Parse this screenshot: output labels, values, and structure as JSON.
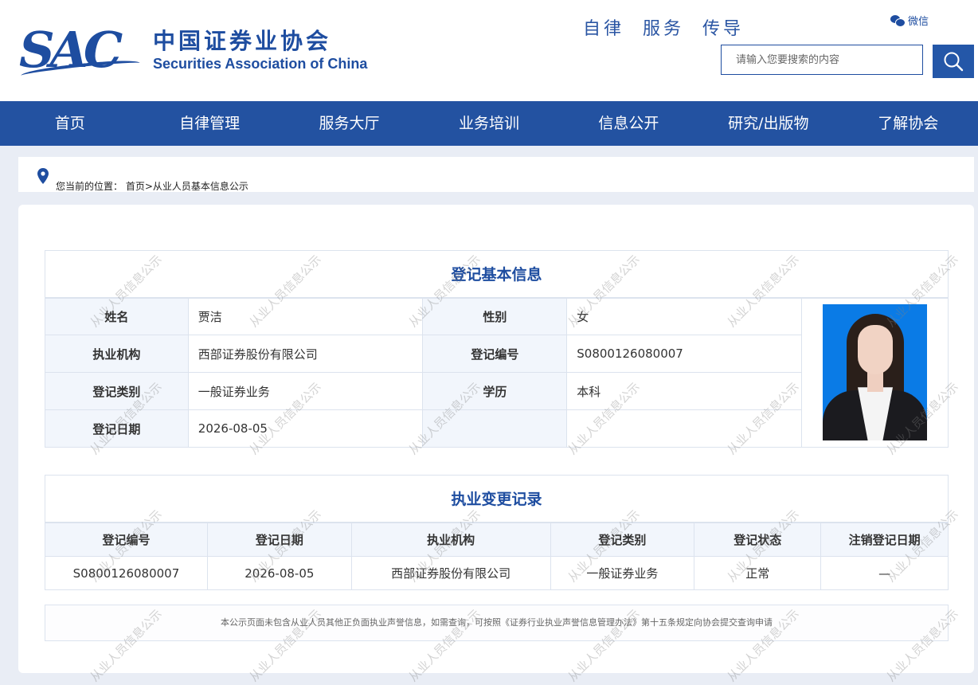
{
  "header": {
    "logo_abbr": "SAC",
    "logo_cn": "中国证券业协会",
    "logo_en": "Securities Association of China",
    "slogan": "自律 服务 传导",
    "wechat_label": "微信",
    "search_placeholder": "请输入您要搜索的内容"
  },
  "nav": {
    "items": [
      "首页",
      "自律管理",
      "服务大厅",
      "业务培训",
      "信息公开",
      "研究/出版物",
      "了解协会"
    ]
  },
  "breadcrumb": {
    "prefix": "您当前的位置：",
    "home": "首页",
    "separator": ">",
    "current": "从业人员基本信息公示"
  },
  "basic_info": {
    "title": "登记基本信息",
    "labels": {
      "name": "姓名",
      "gender": "性别",
      "org": "执业机构",
      "reg_no": "登记编号",
      "reg_type": "登记类别",
      "education": "学历",
      "reg_date": "登记日期"
    },
    "values": {
      "name": "贾洁",
      "gender": "女",
      "org": "西部证券股份有限公司",
      "reg_no": "S0800126080007",
      "reg_type": "一般证券业务",
      "education": "本科",
      "reg_date": "2026-08-05"
    }
  },
  "change_records": {
    "title": "执业变更记录",
    "headers": [
      "登记编号",
      "登记日期",
      "执业机构",
      "登记类别",
      "登记状态",
      "注销登记日期"
    ],
    "rows": [
      [
        "S0800126080007",
        "2026-08-05",
        "西部证券股份有限公司",
        "一般证券业务",
        "正常",
        "—"
      ]
    ]
  },
  "notice": "本公示页面未包含从业人员其他正负面执业声誉信息，如需查询，可按照《证券行业执业声誉信息管理办法》第十五条规定向协会提交查询申请",
  "watermark": "从业人员信息公示",
  "colors": {
    "brand": "#1e4da0",
    "nav_bg": "#2352a1",
    "page_bg": "#e9edf5",
    "header_cell_bg": "#f2f6fc",
    "photo_bg": "#0a7be6"
  }
}
